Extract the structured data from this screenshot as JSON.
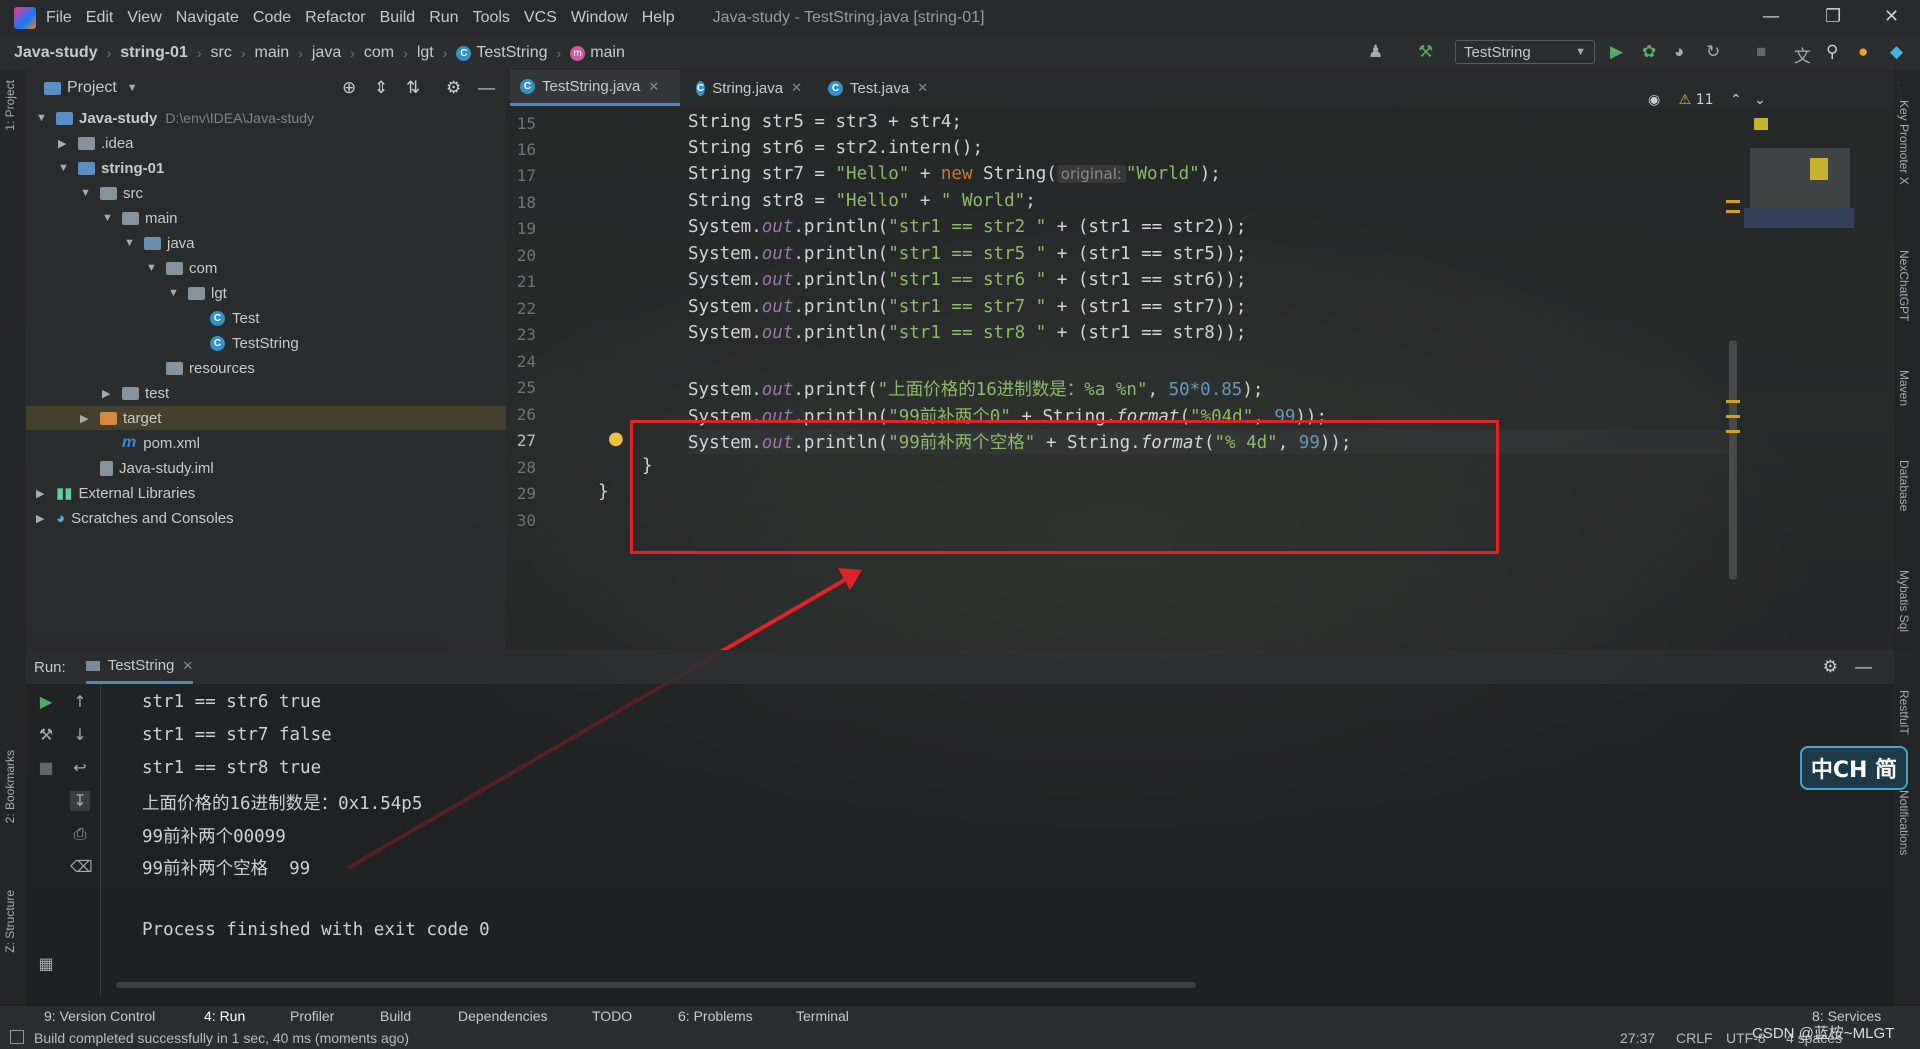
{
  "menubar": {
    "items": [
      "File",
      "Edit",
      "View",
      "Navigate",
      "Code",
      "Refactor",
      "Build",
      "Run",
      "Tools",
      "VCS",
      "Window",
      "Help"
    ],
    "title": "Java-study - TestString.java [string-01]"
  },
  "breadcrumb": [
    "Java-study",
    "string-01",
    "src",
    "main",
    "java",
    "com",
    "lgt",
    "TestString",
    "main"
  ],
  "run_config": "TestString",
  "project": {
    "header": "Project",
    "tree": [
      {
        "label": "Java-study",
        "path": "D:\\env\\IDEA\\Java-study"
      },
      {
        "label": ".idea"
      },
      {
        "label": "string-01"
      },
      {
        "label": "src"
      },
      {
        "label": "main"
      },
      {
        "label": "java"
      },
      {
        "label": "com"
      },
      {
        "label": "lgt"
      },
      {
        "label": "Test"
      },
      {
        "label": "TestString"
      },
      {
        "label": "resources"
      },
      {
        "label": "test"
      },
      {
        "label": "target"
      },
      {
        "label": "pom.xml"
      },
      {
        "label": "Java-study.iml"
      },
      {
        "label": "External Libraries"
      },
      {
        "label": "Scratches and Consoles"
      }
    ]
  },
  "tabs": [
    "TestString.java",
    "String.java",
    "Test.java"
  ],
  "editor": {
    "line_numbers": [
      "15",
      "16",
      "17",
      "18",
      "19",
      "20",
      "21",
      "22",
      "23",
      "24",
      "25",
      "26",
      "27",
      "28",
      "29",
      "30"
    ],
    "warnings": "11",
    "hint_original": "original:",
    "lines": {
      "l15": "String str5 = str3 + str4;",
      "l16": "String str6 = str2.intern();",
      "l17_a": "String str7 = ",
      "l17_s1": "\"Hello\"",
      "l17_b": " + ",
      "l17_k": "new",
      "l17_c": " String(",
      "l17_s2": "\"World\"",
      "l17_d": ");",
      "l18_a": "String str8 = ",
      "l18_s1": "\"Hello\"",
      "l18_b": " + ",
      "l18_s2": "\" World\"",
      "l18_c": ";",
      "println": [
        {
          "s": "\"str1 == str2 \"",
          "e": " + (str1 == str2));"
        },
        {
          "s": "\"str1 == str5 \"",
          "e": " + (str1 == str5));"
        },
        {
          "s": "\"str1 == str6 \"",
          "e": " + (str1 == str6));"
        },
        {
          "s": "\"str1 == str7 \"",
          "e": " + (str1 == str7));"
        },
        {
          "s": "\"str1 == str8 \"",
          "e": " + (str1 == str8));"
        }
      ],
      "sys": "System.",
      "out": "out",
      "printf": ".printf(",
      "println_kw": ".println(",
      "l25_s": "\"上面价格的16进制数是：%a %n\"",
      "l25_n": "50*0.85",
      "l26_s": "\"99前补两个0\"",
      "l27_s": "\"99前补两个空格\"",
      "string_dot": " + String.",
      "format": "format",
      "l26_f": "\"%04d\"",
      "l27_f": "\"% 4d\"",
      "n99": "99",
      "close": "));",
      "close25": ");",
      "comma": ", ",
      "brace28": "}",
      "brace29": "}"
    }
  },
  "run": {
    "label": "Run:",
    "tab": "TestString",
    "output": [
      "str1 == str6 true",
      "str1 == str7 false",
      "str1 == str8 true",
      "上面价格的16进制数是：0x1.54p5",
      "99前补两个00099",
      "99前补两个空格  99",
      "",
      "Process finished with exit code 0"
    ]
  },
  "left_strip": [
    "1: Project",
    "2: Bookmarks",
    "Z: Structure"
  ],
  "right_strip": [
    "Key Promoter X",
    "NexChatGPT",
    "Maven",
    "Database",
    "Mybatis Sql",
    "RestfulT",
    "Notifications"
  ],
  "bottom_tools": [
    "9: Version Control",
    "4: Run",
    "Profiler",
    "Build",
    "Dependencies",
    "TODO",
    "6: Problems",
    "Terminal",
    "8: Services"
  ],
  "status": {
    "message": "Build completed successfully in 1 sec, 40 ms (moments ago)",
    "position": "27:37",
    "line_sep": "CRLF",
    "encoding": "UTF-8",
    "indent": "4 spaces",
    "watermark": "CSDN @蓝桉~MLGT"
  },
  "ime": "中CH 简",
  "colors": {
    "accent": "#4a88c7",
    "highlight_box": "#e02327",
    "string": "#8fb96a",
    "keyword": "#cc7832",
    "number": "#6897bb",
    "field": "#9876aa"
  }
}
